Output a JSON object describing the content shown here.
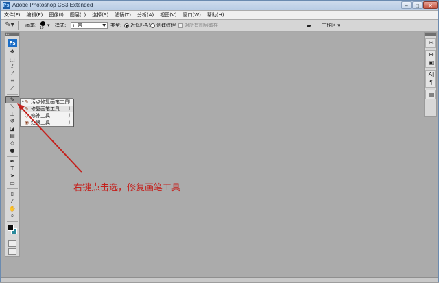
{
  "window": {
    "title": "Adobe Photoshop CS3 Extended",
    "app_icon": "Ps",
    "minimize_glyph": "–",
    "maximize_glyph": "□",
    "close_glyph": "✕"
  },
  "menubar": {
    "items": [
      "文件(F)",
      "编辑(E)",
      "图像(I)",
      "图层(L)",
      "选择(S)",
      "滤镜(T)",
      "分析(A)",
      "视图(V)",
      "窗口(W)",
      "帮助(H)"
    ]
  },
  "options": {
    "brush_label": "画笔:",
    "brush_size": "19",
    "mode_label": "模式:",
    "mode_value": "正常",
    "type_label": "类型:",
    "type_option_1": "近似匹配",
    "type_option_2": "创建纹理",
    "sample_all_label": "对所有图层取样",
    "workspace_label": "工作区 ▾"
  },
  "toolbox": {
    "logo": "Ps",
    "tools": [
      {
        "name": "move-tool",
        "glyph": "✥"
      },
      {
        "name": "marquee-tool",
        "glyph": "⬚"
      },
      {
        "name": "lasso-tool",
        "glyph": "ℓ"
      },
      {
        "name": "magic-wand-tool",
        "glyph": "⁄"
      },
      {
        "name": "crop-tool",
        "glyph": "⌗"
      },
      {
        "name": "slice-tool",
        "glyph": "⟋"
      },
      {
        "name": "healing-brush-tool",
        "glyph": "✎"
      },
      {
        "name": "brush-tool",
        "glyph": "⟍"
      },
      {
        "name": "clone-stamp-tool",
        "glyph": "⊥"
      },
      {
        "name": "history-brush-tool",
        "glyph": "↺"
      },
      {
        "name": "eraser-tool",
        "glyph": "◪"
      },
      {
        "name": "gradient-tool",
        "glyph": "▤"
      },
      {
        "name": "blur-tool",
        "glyph": "◇"
      },
      {
        "name": "dodge-tool",
        "glyph": "●"
      },
      {
        "name": "pen-tool",
        "glyph": "✒"
      },
      {
        "name": "type-tool",
        "glyph": "T"
      },
      {
        "name": "path-selection-tool",
        "glyph": "➤"
      },
      {
        "name": "shape-tool",
        "glyph": "▭"
      },
      {
        "name": "notes-tool",
        "glyph": "▯"
      },
      {
        "name": "eyedropper-tool",
        "glyph": "⁄"
      },
      {
        "name": "hand-tool",
        "glyph": "✋"
      },
      {
        "name": "zoom-tool",
        "glyph": "⌕"
      }
    ],
    "foreground_color": "#0c0c0c",
    "background_color": "#2a8a9c"
  },
  "flyout": {
    "items": [
      {
        "label": "污点修复画笔工具",
        "shortcut": "J",
        "selected": true
      },
      {
        "label": "修复画笔工具",
        "shortcut": "J",
        "selected": false
      },
      {
        "label": "修补工具",
        "shortcut": "J",
        "selected": false
      },
      {
        "label": "红眼工具",
        "shortcut": "J",
        "selected": false
      }
    ]
  },
  "annotation": {
    "text": "右键点击选，修复画笔工具",
    "color": "#c4201c"
  },
  "rightdock": {
    "groups": [
      [
        "brushes-icon"
      ],
      [
        "clone-source-icon",
        "tool-presets-icon"
      ],
      [
        "character-icon",
        "paragraph-icon"
      ],
      [
        "layer-comps-icon"
      ]
    ]
  },
  "colors": {
    "canvas_bg": "#ababab",
    "titlebar": "#c5d6ea",
    "accent": "#1c6ec6"
  }
}
